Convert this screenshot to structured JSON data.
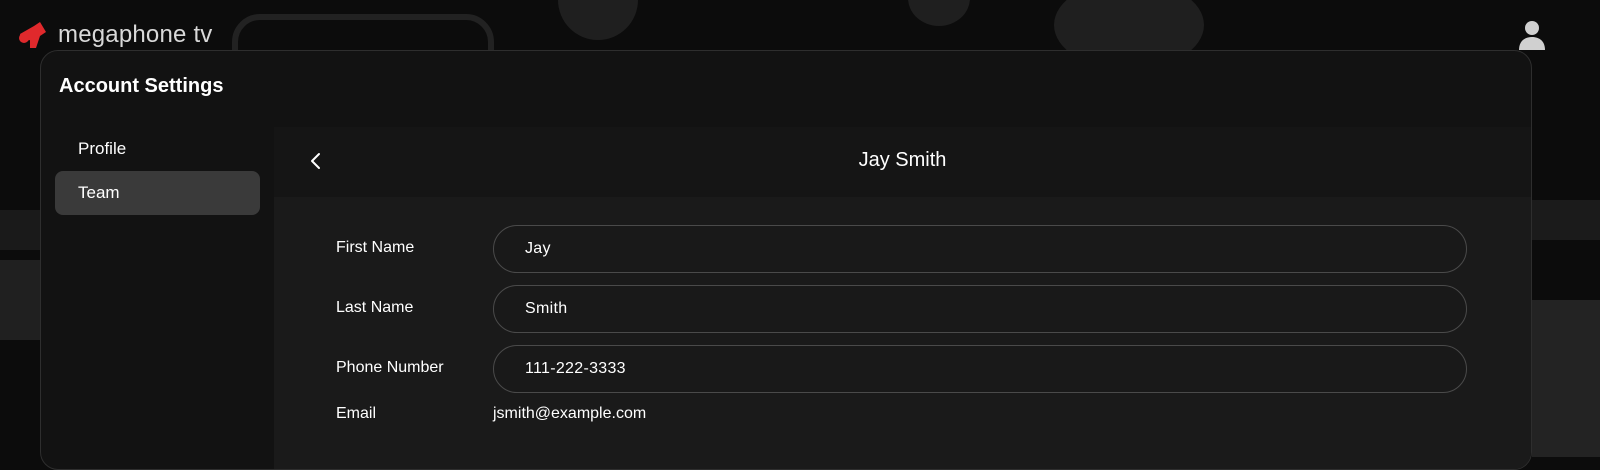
{
  "app": {
    "brand_name": "megaphone tv",
    "brand_color": "#e0292c"
  },
  "icons": {
    "logo": "megaphone-icon",
    "user": "user-icon",
    "back": "chevron-left-icon"
  },
  "settings": {
    "title": "Account Settings",
    "nav": [
      {
        "label": "Profile",
        "active": false
      },
      {
        "label": "Team",
        "active": true
      }
    ]
  },
  "member": {
    "header_title": "Jay Smith",
    "fields": {
      "first_name": {
        "label": "First Name",
        "value": "Jay"
      },
      "last_name": {
        "label": "Last Name",
        "value": "Smith"
      },
      "phone": {
        "label": "Phone Number",
        "value": "111-222-3333"
      },
      "email": {
        "label": "Email",
        "value": "jsmith@example.com"
      }
    }
  }
}
